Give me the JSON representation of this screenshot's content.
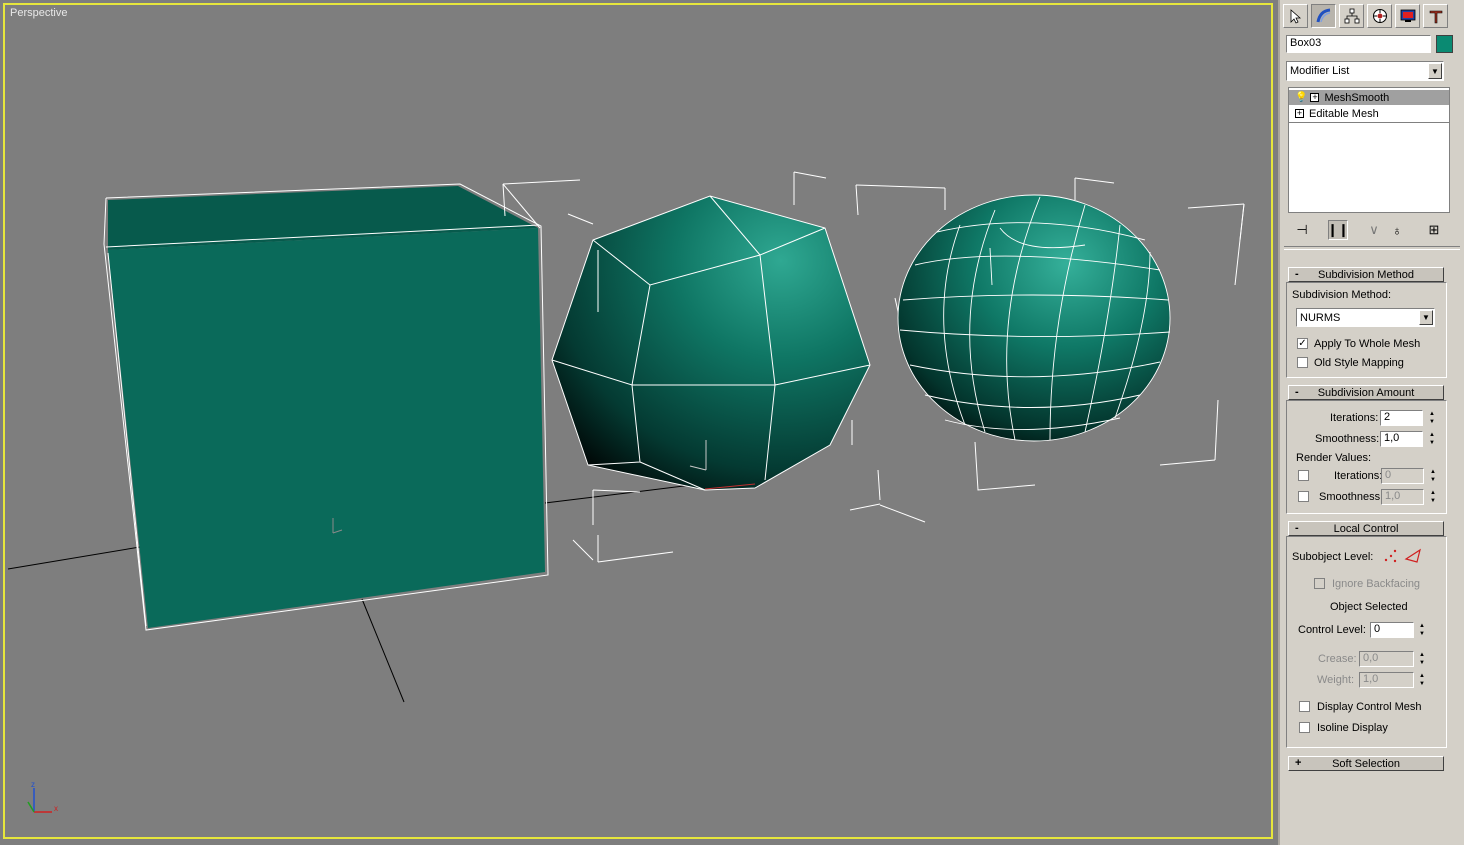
{
  "viewport": {
    "label": "Perspective",
    "axis_labels": {
      "z": "z",
      "x": "x"
    }
  },
  "colors": {
    "viewport_bg": "#7e7e7e",
    "object_color": "#0a6a5a",
    "active_border": "#e6e63c"
  },
  "panel": {
    "tabs": [
      {
        "name": "create",
        "icon": "create-icon"
      },
      {
        "name": "modify",
        "icon": "modify-icon"
      },
      {
        "name": "hierarchy",
        "icon": "hierarchy-icon"
      },
      {
        "name": "motion",
        "icon": "motion-icon"
      },
      {
        "name": "display",
        "icon": "display-icon"
      },
      {
        "name": "utilities",
        "icon": "utilities-icon"
      }
    ],
    "object_name": "Box03",
    "modifier_list": "Modifier List",
    "stack": [
      {
        "label": "MeshSmooth",
        "selected": true
      },
      {
        "label": "Editable Mesh",
        "selected": false
      }
    ],
    "subdivision_method": {
      "title": "Subdivision Method",
      "label": "Subdivision Method:",
      "value": "NURMS",
      "apply_whole_mesh": "Apply To Whole Mesh",
      "apply_whole_mesh_checked": true,
      "old_style_mapping": "Old Style Mapping",
      "old_style_mapping_checked": false
    },
    "subdivision_amount": {
      "title": "Subdivision Amount",
      "iterations_label": "Iterations:",
      "iterations_value": "2",
      "smoothness_label": "Smoothness:",
      "smoothness_value": "1,0",
      "render_values_label": "Render Values:",
      "render_iterations_label": "Iterations:",
      "render_iterations_value": "0",
      "render_smoothness_label": "Smoothness:",
      "render_smoothness_value": "1,0"
    },
    "local_control": {
      "title": "Local Control",
      "subobject_label": "Subobject Level:",
      "ignore_backfacing": "Ignore Backfacing",
      "object_selected": "Object Selected",
      "control_level_label": "Control Level:",
      "control_level_value": "0",
      "crease_label": "Crease:",
      "crease_value": "0,0",
      "weight_label": "Weight:",
      "weight_value": "1,0",
      "display_control_mesh": "Display Control Mesh",
      "isoline_display": "Isoline Display"
    },
    "soft_selection": {
      "title": "Soft Selection"
    }
  }
}
